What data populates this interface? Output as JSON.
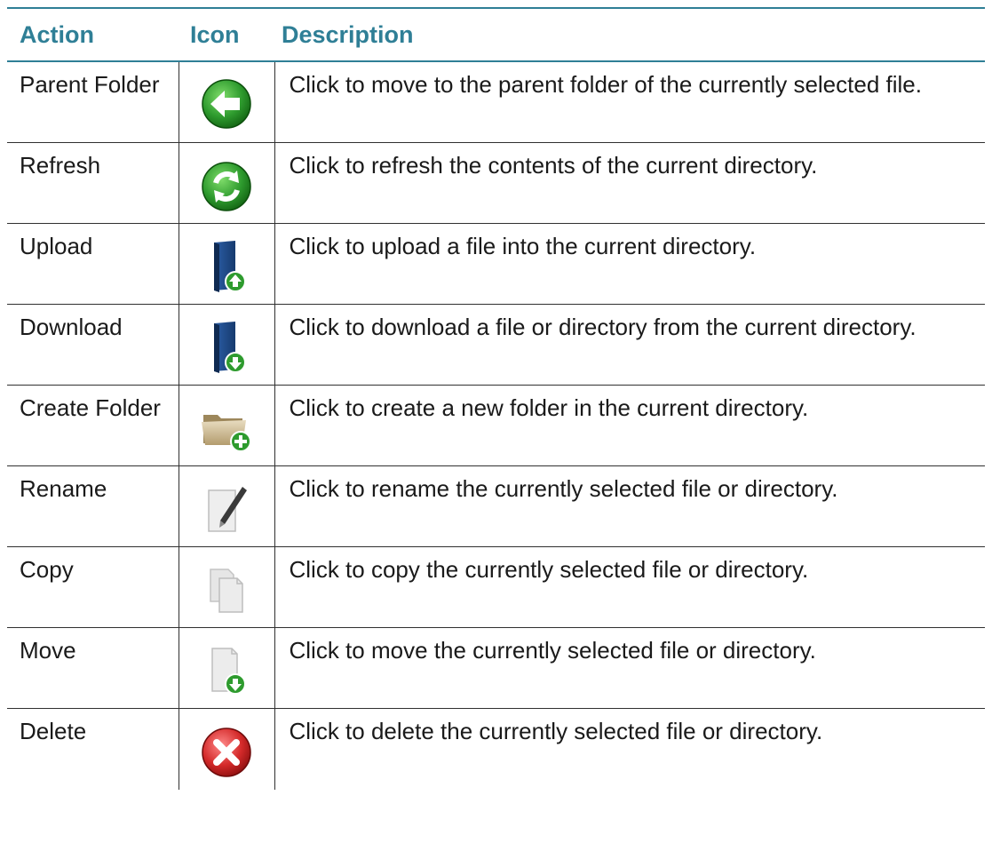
{
  "table": {
    "headers": {
      "action": "Action",
      "icon": "Icon",
      "description": "Description"
    },
    "rows": [
      {
        "action": "Parent Folder",
        "icon": "parent-folder-icon",
        "description": "Click to move to the parent folder of the currently selected file."
      },
      {
        "action": "Refresh",
        "icon": "refresh-icon",
        "description": "Click to refresh the contents of the current directory."
      },
      {
        "action": "Upload",
        "icon": "upload-icon",
        "description": "Click to upload a file into the current directory."
      },
      {
        "action": "Download",
        "icon": "download-icon",
        "description": "Click to download a file or directory from the current directory."
      },
      {
        "action": "Create Folder",
        "icon": "create-folder-icon",
        "description": "Click to create a new folder in the current directory."
      },
      {
        "action": "Rename",
        "icon": "rename-icon",
        "description": "Click to rename the currently selected file or directory."
      },
      {
        "action": "Copy",
        "icon": "copy-icon",
        "description": "Click to copy the currently selected file or directory."
      },
      {
        "action": "Move",
        "icon": "move-icon",
        "description": "Click to move the currently selected file or directory."
      },
      {
        "action": "Delete",
        "icon": "delete-icon",
        "description": "Click to delete the currently selected file or directory."
      }
    ]
  },
  "colors": {
    "header_text": "#2f7f96",
    "header_rule": "#2f7f96",
    "body_text": "#1a1a1a",
    "cell_border": "#303030",
    "icon_green": "#2e9b2e",
    "icon_blue": "#1f4f8f",
    "icon_red": "#d42a2a",
    "icon_tan": "#c9b48a",
    "icon_gray": "#e6e6e6"
  }
}
